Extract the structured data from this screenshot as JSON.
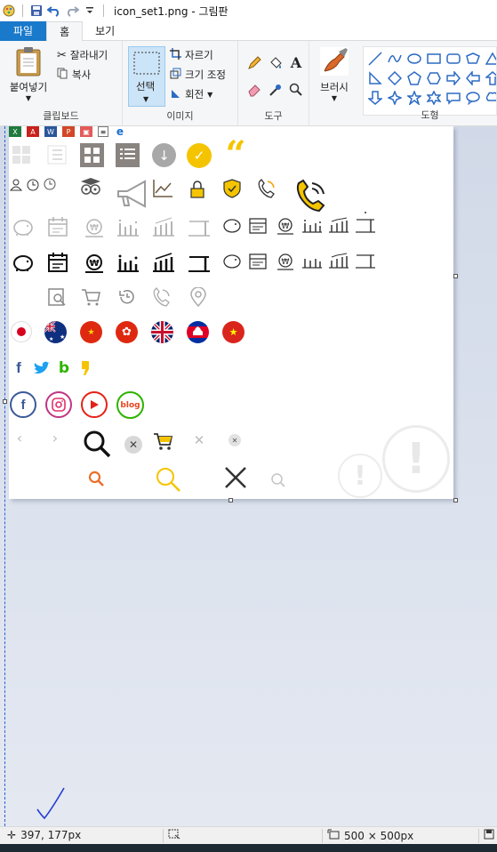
{
  "window": {
    "title": "icon_set1.png - 그림판",
    "quick_access": [
      "paint-app-icon",
      "save-icon",
      "undo-icon",
      "redo-icon",
      "customize-dropdown-icon"
    ]
  },
  "tabs": [
    {
      "label": "파일"
    },
    {
      "label": "홈"
    },
    {
      "label": "보기"
    }
  ],
  "ribbon": {
    "clipboard": {
      "label": "클립보드",
      "paste": "붙여넣기",
      "cut": "잘라내기",
      "copy": "복사"
    },
    "image": {
      "label": "이미지",
      "select": "선택",
      "crop": "자르기",
      "resize": "크기 조정",
      "rotate": "회전"
    },
    "tools": {
      "label": "도구"
    },
    "brush": {
      "label": "브러시"
    },
    "shapes": {
      "label": "도형"
    }
  },
  "canvas_icons": {
    "social_labels": [
      "f",
      "blog"
    ]
  },
  "status": {
    "cursor_position": "397, 177px",
    "image_size": "500 × 500px"
  },
  "colors": {
    "file_tab": "#1979ca",
    "selection": "#cce4f7",
    "accent_yellow": "#f5c400",
    "gray_icon": "#8a8480",
    "workspace": "#d1d9e8"
  }
}
